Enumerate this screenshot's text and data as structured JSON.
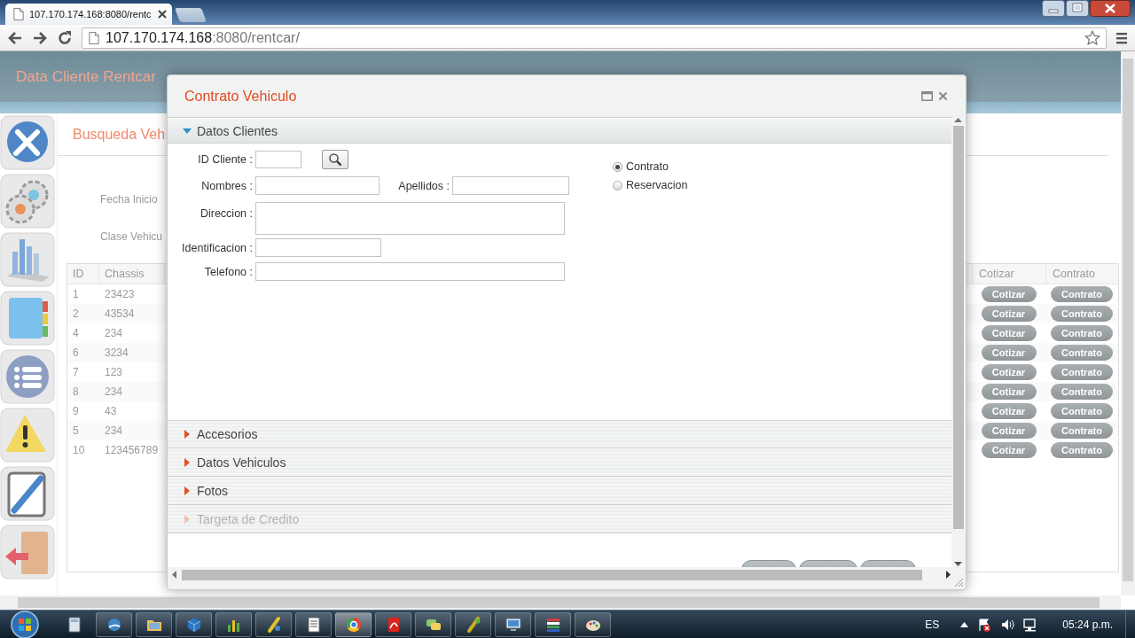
{
  "browser": {
    "tab_title": "107.170.174.168:8080/rentc",
    "url_host": "107.170.174.168",
    "url_rest": ":8080/rentcar/"
  },
  "page": {
    "app_title": "Data Cliente Rentcar",
    "section_title": "Busqueda Veh",
    "filters": [
      "Fecha Inicio",
      "Clase Vehicu"
    ],
    "table": {
      "columns": [
        "ID",
        "Chassis"
      ],
      "action_columns": [
        "Cotizar",
        "Contrato"
      ],
      "rows": [
        {
          "id": "1",
          "chassis": "23423",
          "actions": [
            "Cotizar",
            "Contrato"
          ]
        },
        {
          "id": "2",
          "chassis": "43534",
          "actions": [
            "Cotizar",
            "Contrato"
          ]
        },
        {
          "id": "4",
          "chassis": "234",
          "actions": [
            "Cotizar",
            "Contrato"
          ]
        },
        {
          "id": "6",
          "chassis": "3234",
          "actions": [
            "Cotizar",
            "Contrato"
          ]
        },
        {
          "id": "7",
          "chassis": "123",
          "actions": [
            "Cotizar",
            "Contrato"
          ]
        },
        {
          "id": "8",
          "chassis": "234",
          "actions": [
            "Cotizar",
            "Contrato"
          ]
        },
        {
          "id": "9",
          "chassis": "43",
          "actions": [
            "Cotizar",
            "Contrato"
          ]
        },
        {
          "id": "5",
          "chassis": "234",
          "actions": [
            "Cotizar",
            "Contrato"
          ]
        },
        {
          "id": "10",
          "chassis": "123456789",
          "actions": [
            "Cotizar",
            "Contrato"
          ]
        }
      ]
    }
  },
  "dialog": {
    "title": "Contrato Vehiculo",
    "sections": [
      {
        "label": "Datos Clientes",
        "expanded": true,
        "disabled": false
      },
      {
        "label": "Accesorios",
        "expanded": false,
        "disabled": false
      },
      {
        "label": "Datos Vehiculos",
        "expanded": false,
        "disabled": false
      },
      {
        "label": "Fotos",
        "expanded": false,
        "disabled": false
      },
      {
        "label": "Targeta de Credito",
        "expanded": false,
        "disabled": true
      }
    ],
    "form": {
      "id_label": "ID Cliente :",
      "names_label": "Nombres :",
      "surnames_label": "Apellidos :",
      "address_label": "Direccion :",
      "identification_label": "Identificacion :",
      "phone_label": "Telefono :"
    },
    "options": [
      {
        "label": "Contrato",
        "selected": true
      },
      {
        "label": "Reservacion",
        "selected": false
      }
    ]
  },
  "taskbar": {
    "language": "ES",
    "clock": "05:24 p.m."
  }
}
